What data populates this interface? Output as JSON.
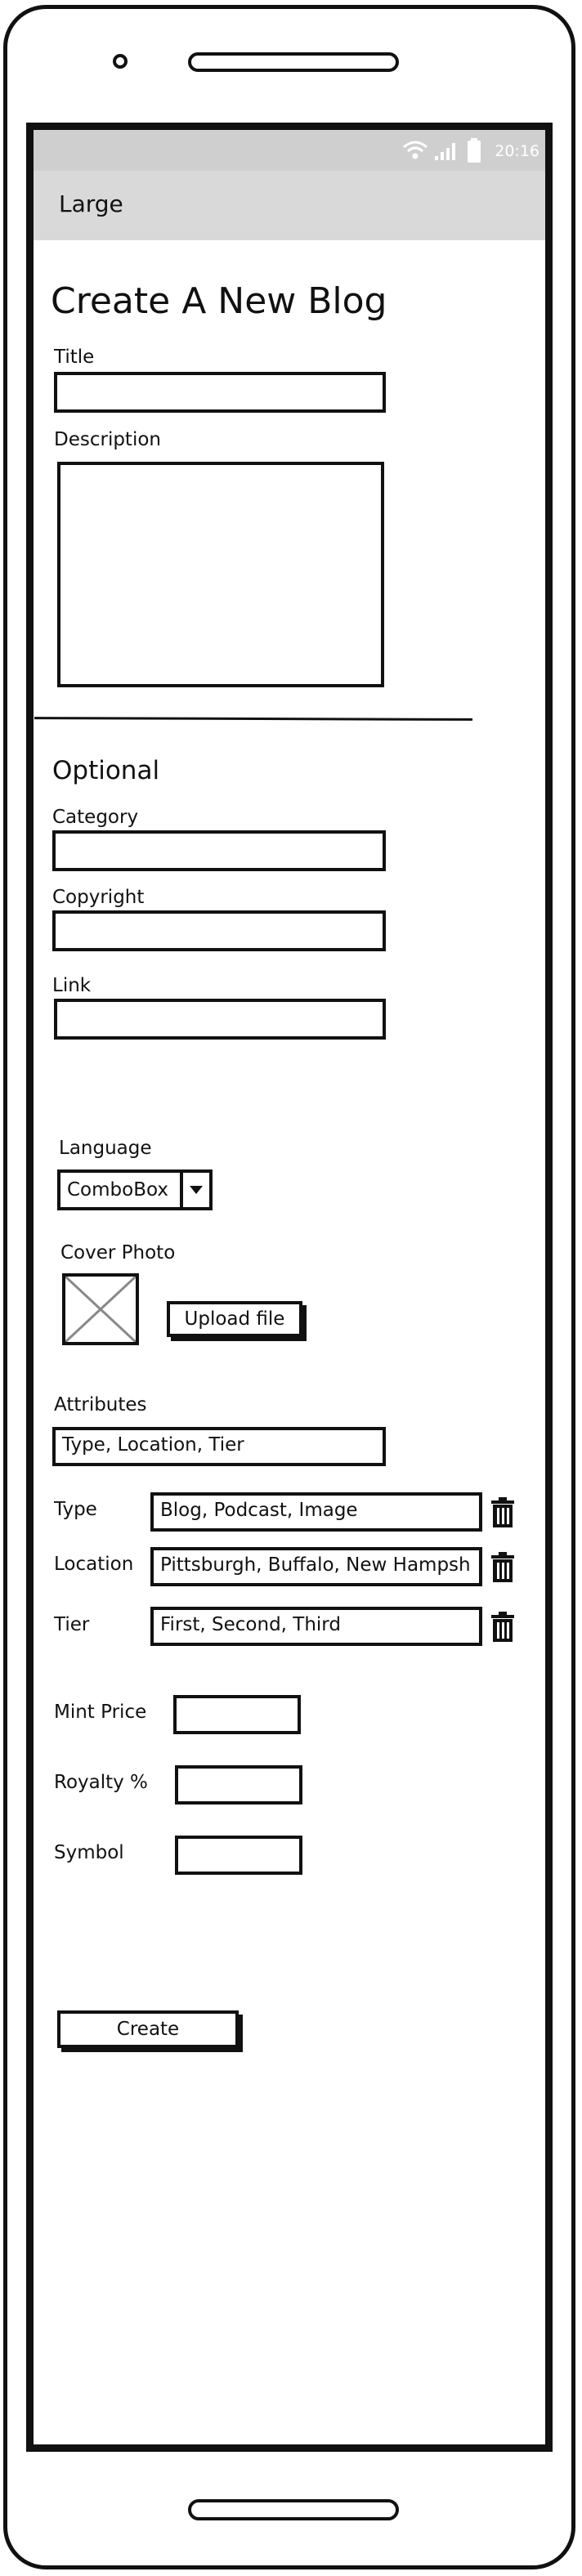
{
  "status_bar": {
    "time": "20:16"
  },
  "app_bar": {
    "title": "Large"
  },
  "form": {
    "heading": "Create A New Blog",
    "title_label": "Title",
    "description_label": "Description",
    "optional_heading": "Optional",
    "category_label": "Category",
    "copyright_label": "Copyright",
    "link_label": "Link",
    "language_label": "Language",
    "language_value": "ComboBox",
    "cover_photo_label": "Cover Photo",
    "upload_button": "Upload file",
    "attributes_label": "Attributes",
    "attributes_value": "Type, Location, Tier",
    "attribute_rows": [
      {
        "label": "Type",
        "value": "Blog, Podcast, Image"
      },
      {
        "label": "Location",
        "value": "Pittsburgh, Buffalo, New Hampsh"
      },
      {
        "label": "Tier",
        "value": "First, Second, Third"
      }
    ],
    "mint_price_label": "Mint Price",
    "royalty_label": "Royalty %",
    "symbol_label": "Symbol",
    "create_button": "Create"
  },
  "icons": {
    "wifi": "wifi-icon",
    "signal": "signal-icon",
    "battery": "battery-icon",
    "dropdown": "chevron-down-icon",
    "image_placeholder": "image-placeholder-icon",
    "delete": "trash-icon"
  }
}
